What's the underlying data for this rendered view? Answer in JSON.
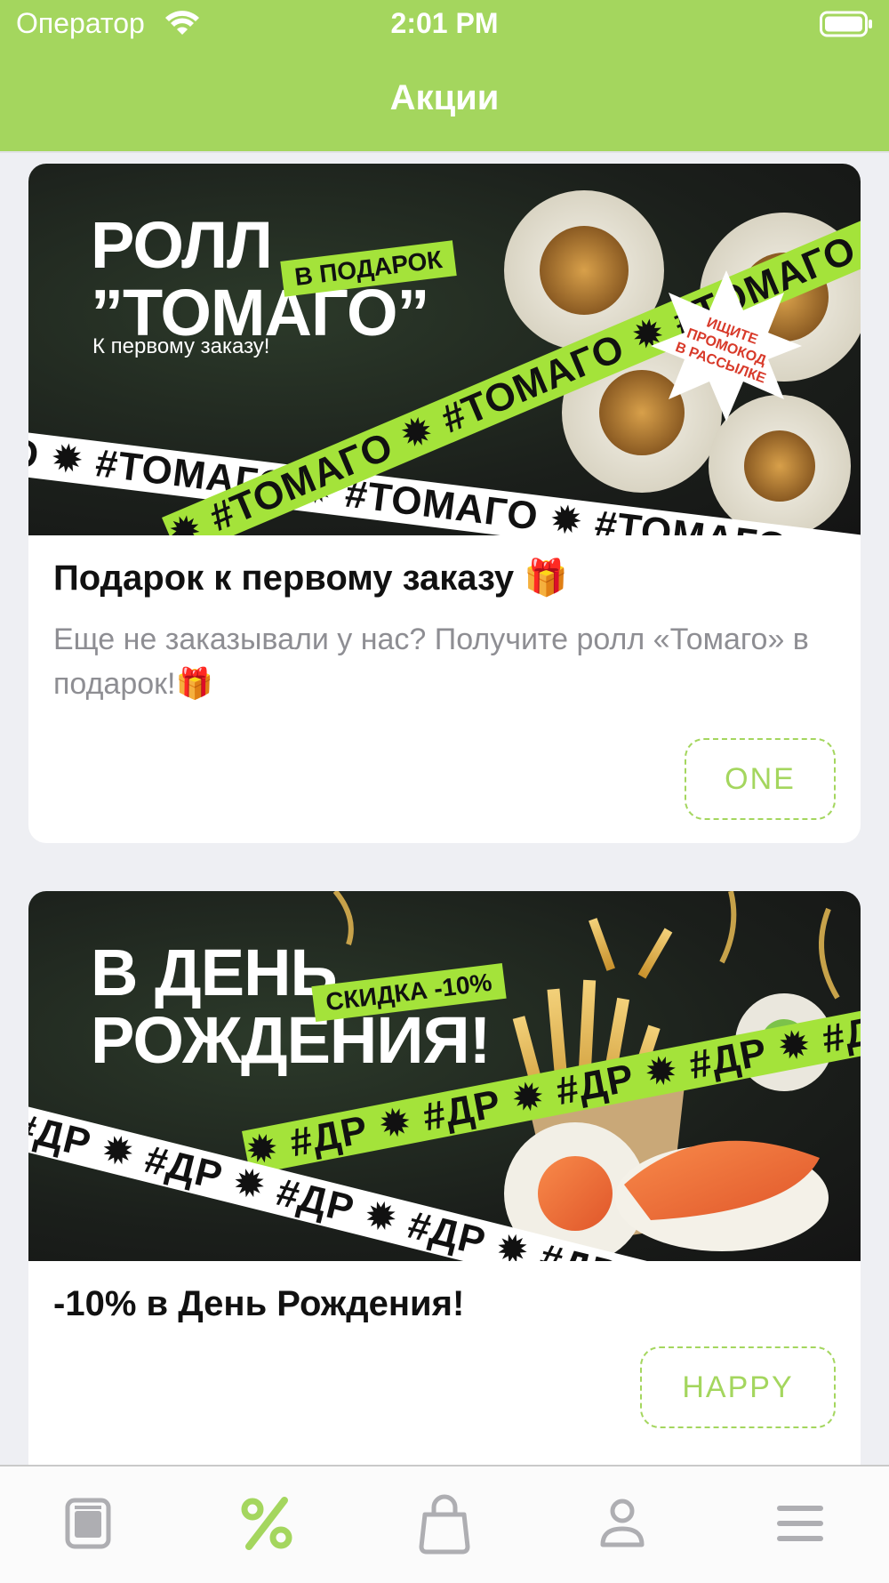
{
  "status_bar": {
    "carrier": "Оператор",
    "time": "2:01 PM"
  },
  "nav": {
    "title": "Акции"
  },
  "colors": {
    "accent": "#a4d65e",
    "tape_green": "#a4e33a",
    "text_secondary": "#8e8e93",
    "background": "#eeeff3"
  },
  "promotions": [
    {
      "banner": {
        "title_line1": "РОЛЛ",
        "title_line2": "”ТОМАГО”",
        "subtitle": "К первому заказу!",
        "tag": "В ПОДАРОК",
        "star_line1": "ИЩИТЕ",
        "star_line2": "ПРОМОКОД",
        "star_line3": "В РАССЫЛКЕ",
        "tape_green_text": "✹ #ТОМАГО ✹ #ТОМАГО ✹ #ТОМАГО",
        "tape_white_text": "О ✹ #ТОМАГО ✹ #ТОМАГО ✹ #ТОМАГО ✹ #ТОМА"
      },
      "title": "Подарок к первому заказу 🎁",
      "description": "Еще не заказывали у нас? Получите ролл «Томаго» в подарок!🎁",
      "promo_code": "ONE"
    },
    {
      "banner": {
        "title_line1": "В ДЕНЬ",
        "title_line2": "РОЖДЕНИЯ!",
        "tag": "СКИДКА -10%",
        "tape_green_text": "✹ #ДР ✹ #ДР ✹ #ДР ✹ #ДР ✹ #Д",
        "tape_white_text": "#ДР ✹ #ДР ✹ #ДР ✹ #ДР ✹ #ДР"
      },
      "title": "-10% в День Рождения!",
      "description": "",
      "promo_code": "HAPPY"
    }
  ],
  "tabbar": {
    "items": [
      {
        "icon": "menu-book-icon",
        "active": false
      },
      {
        "icon": "percent-icon",
        "active": true
      },
      {
        "icon": "shopping-bag-icon",
        "active": false
      },
      {
        "icon": "profile-icon",
        "active": false
      },
      {
        "icon": "hamburger-icon",
        "active": false
      }
    ]
  }
}
